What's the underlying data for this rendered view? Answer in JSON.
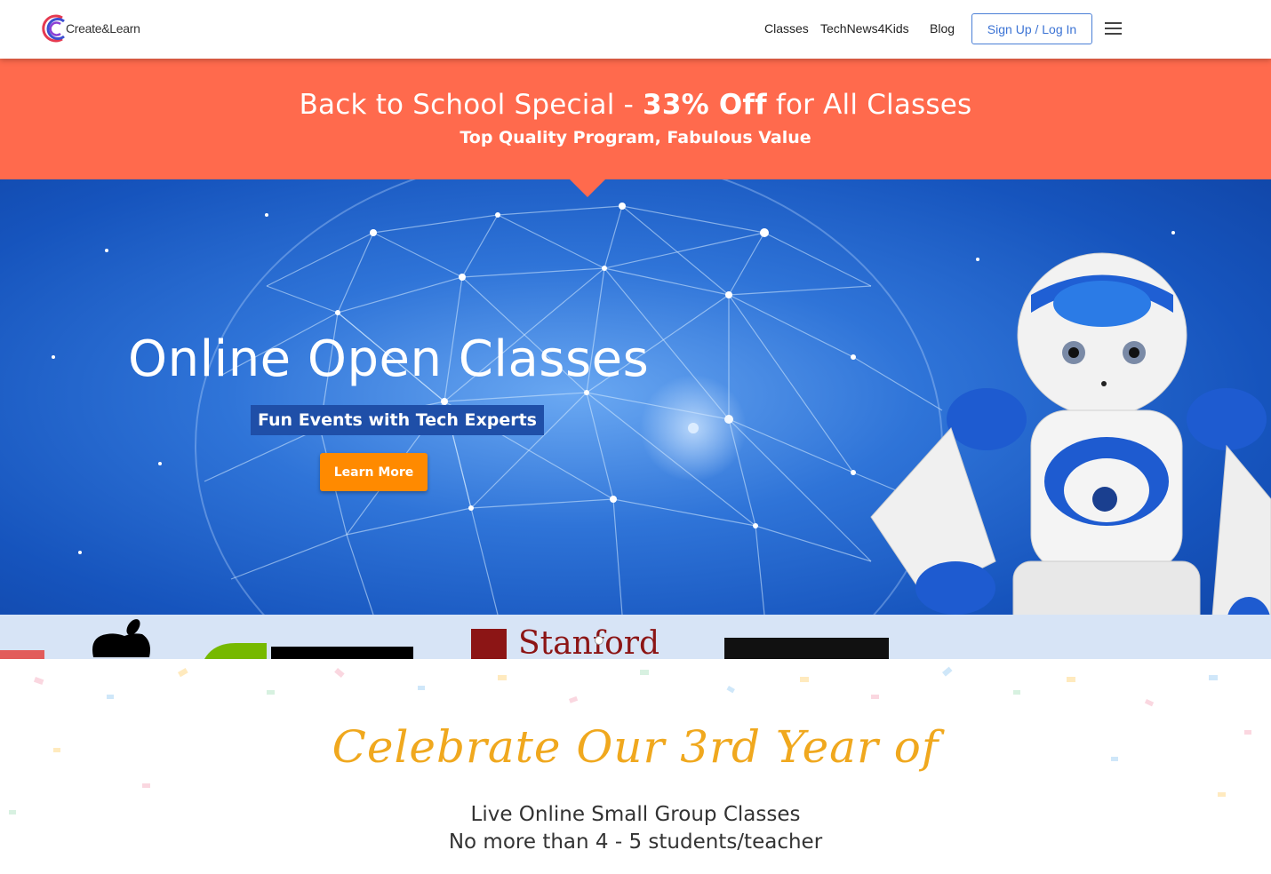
{
  "header": {
    "logo_text": "Create&Learn",
    "nav": [
      "Classes",
      "TechNews4Kids",
      "Blog"
    ],
    "signup_label": "Sign Up / Log In"
  },
  "promo": {
    "line1_a": "Back to School Special - ",
    "line1_b": "33% Off",
    "line1_c": " for All Classes",
    "line2": "Top Quality Program, Fabulous Value",
    "color": "#ff6a4d"
  },
  "hero": {
    "title": "Online Open Classes",
    "subtitle": "Fun Events with Tech Experts",
    "button_label": "Learn More",
    "button_color": "#ff8a00",
    "partners": [
      "Stanford"
    ]
  },
  "celebrate": {
    "title": "Celebrate Our 3rd Year of",
    "line1": "Live Online Small Group Classes",
    "line2": "No more than 4 - 5 students/teacher",
    "title_color": "#f0a81e"
  }
}
